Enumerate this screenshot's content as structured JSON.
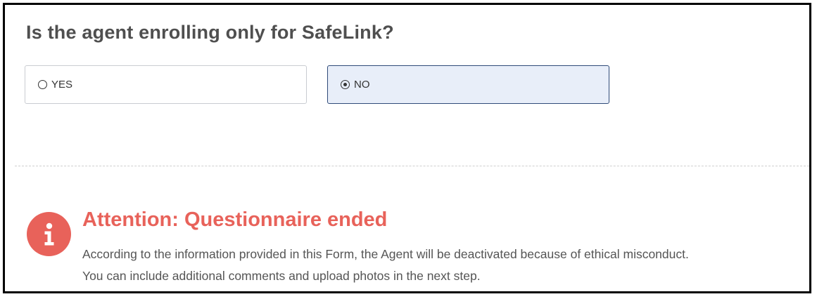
{
  "question": {
    "text": "Is the agent enrolling only for SafeLink?"
  },
  "options": [
    {
      "label": "YES",
      "selected": false
    },
    {
      "label": "NO",
      "selected": true
    }
  ],
  "alert": {
    "icon": "info-icon",
    "color": "#e8625a",
    "title": "Attention: Questionnaire ended",
    "line1": "According to the information provided in this Form, the Agent will be deactivated because of ethical misconduct.",
    "line2": "You can include additional comments and upload photos in the next step."
  },
  "colors": {
    "selected_border": "#2f4a78",
    "selected_background": "#e8eef9",
    "question_text": "#4f4f4f"
  }
}
